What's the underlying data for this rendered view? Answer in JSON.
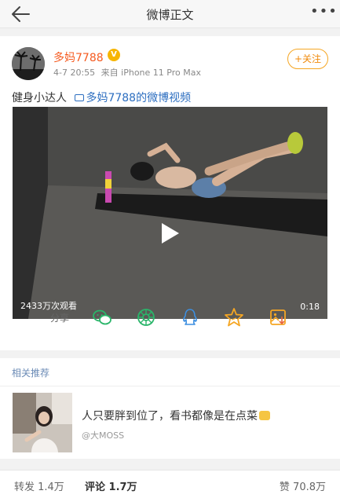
{
  "header": {
    "title": "微博正文"
  },
  "post": {
    "username": "多妈7788",
    "vip_badge": "V",
    "timestamp": "4-7 20:55",
    "source": "来自 iPhone 11 Pro Max",
    "follow_label": "+关注",
    "text": "健身小达人",
    "video_link": "多妈7788的微博视频",
    "video": {
      "view_count": "2433万次观看",
      "duration": "0:18"
    },
    "share_label": "分享",
    "share_icons": [
      "wechat-icon",
      "moments-icon",
      "qq-icon",
      "favorite-star-icon",
      "save-image-icon"
    ]
  },
  "related": {
    "title": "相关推荐",
    "item": {
      "text": "人只要胖到位了，看书都像是在点菜",
      "author": "@大MOSS"
    }
  },
  "bottom": {
    "repost": "转发 1.4万",
    "comment": "评论 1.7万",
    "like": "赞 70.8万"
  },
  "colors": {
    "accent": "#f08a0b",
    "username": "#f55a1f",
    "link": "#2c6ec0",
    "share_icon": "#2ab56a",
    "related_title": "#6b8bb6"
  }
}
